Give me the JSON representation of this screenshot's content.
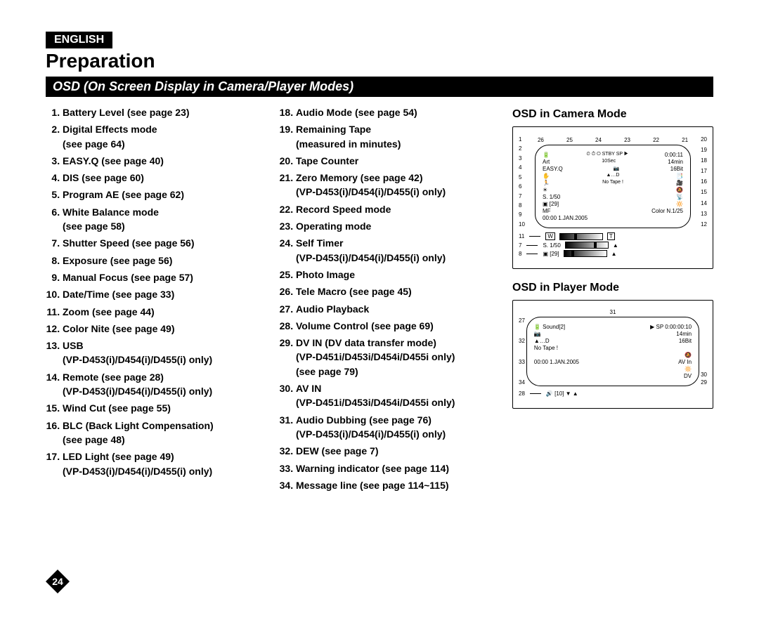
{
  "lang": "ENGLISH",
  "title": "Preparation",
  "subtitle": "OSD (On Screen Display in Camera/Player Modes)",
  "page_number": "24",
  "col_left": [
    {
      "t": "Battery Level (see page 23)"
    },
    {
      "t": "Digital Effects mode",
      "s": "(see page 64)"
    },
    {
      "t": "EASY.Q (see page 40)"
    },
    {
      "t": "DIS (see page 60)"
    },
    {
      "t": "Program AE (see page 62)"
    },
    {
      "t": "White Balance mode",
      "s": "(see page 58)"
    },
    {
      "t": "Shutter Speed (see page 56)"
    },
    {
      "t": "Exposure (see page 56)"
    },
    {
      "t": "Manual Focus (see page 57)"
    },
    {
      "t": "Date/Time (see page 33)"
    },
    {
      "t": "Zoom (see page 44)"
    },
    {
      "t": "Color Nite (see page 49)"
    },
    {
      "t": "USB",
      "s": "(VP-D453(i)/D454(i)/D455(i) only)"
    },
    {
      "t": "Remote (see page 28)",
      "s": "(VP-D453(i)/D454(i)/D455(i) only)"
    },
    {
      "t": "Wind Cut (see page 55)"
    },
    {
      "t": "BLC (Back Light Compensation)",
      "s": "(see page 48)"
    },
    {
      "t": "LED Light (see page 49)",
      "s": "(VP-D453(i)/D454(i)/D455(i) only)"
    }
  ],
  "col_mid_start": 18,
  "col_mid": [
    {
      "t": "Audio Mode (see page 54)"
    },
    {
      "t": "Remaining Tape",
      "s": "(measured in minutes)"
    },
    {
      "t": "Tape Counter"
    },
    {
      "t": "Zero Memory (see page 42)",
      "s": "(VP-D453(i)/D454(i)/D455(i) only)"
    },
    {
      "t": "Record Speed mode"
    },
    {
      "t": "Operating mode"
    },
    {
      "t": "Self Timer",
      "s": "(VP-D453(i)/D454(i)/D455(i) only)"
    },
    {
      "t": "Photo Image"
    },
    {
      "t": "Tele Macro (see page 45)"
    },
    {
      "t": "Audio Playback"
    },
    {
      "t": "Volume Control (see page 69)"
    },
    {
      "t": "DV IN (DV data transfer mode)",
      "s": "(VP-D451i/D453i/D454i/D455i only)\n(see page 79)"
    },
    {
      "t": "AV IN",
      "s": "(VP-D451i/D453i/D454i/D455i only)"
    },
    {
      "t": "Audio Dubbing (see page 76)",
      "s": "(VP-D453(i)/D454(i)/D455(i) only)"
    },
    {
      "t": "DEW (see page 7)"
    },
    {
      "t": "Warning indicator (see page 114)"
    },
    {
      "t": "Message line (see page 114~115)"
    }
  ],
  "camera_title": "OSD in Camera Mode",
  "player_title": "OSD in Player Mode",
  "camera": {
    "top_nums": [
      "26",
      "25",
      "24",
      "23",
      "22",
      "21"
    ],
    "left_nums": [
      "1",
      "2",
      "3",
      "4",
      "5",
      "6",
      "7",
      "8",
      "9",
      "10"
    ],
    "right_nums": [
      "20",
      "19",
      "18",
      "17",
      "16",
      "15",
      "14",
      "13",
      "12"
    ],
    "bottom_labels": {
      "left": "11",
      "s7": "7",
      "s8": "8"
    },
    "lines_left": [
      "🔋",
      "Art",
      "EASY.Q",
      "✋",
      "🏃",
      "☀",
      "S. 1/50",
      "▣ [29]",
      "MF",
      "00:00  1.JAN.2005"
    ],
    "lines_mid": [
      "⏲ ⏱ ⭘  STBY SP ▶",
      "10Sec",
      "📷",
      "▲…D",
      "No Tape !"
    ],
    "lines_right": [
      "0:00:11",
      "14min",
      "16Bit",
      "📑",
      "🎥",
      "🔕",
      "📡",
      "🔆",
      "Color N.1/25"
    ],
    "extra": {
      "zoom": "W      T",
      "s7": "S. 1/50",
      "s8": "▣ [29]"
    }
  },
  "player": {
    "top_num": "31",
    "left_nums": [
      "27",
      "32",
      "33",
      "34"
    ],
    "right_nums": [
      "30",
      "29"
    ],
    "lines_left": [
      "🔋 Sound[2]",
      "      📷",
      "▲…D",
      "No Tape !",
      "",
      "00:00 1.JAN.2005"
    ],
    "lines_right": [
      "▶ SP 0:00:00:10",
      "14min",
      "16Bit",
      "",
      "🔕",
      "AV In",
      "🔆",
      "DV"
    ],
    "bottom": {
      "k": "28",
      "v": "🔊 [10] ▼   ▲"
    }
  }
}
